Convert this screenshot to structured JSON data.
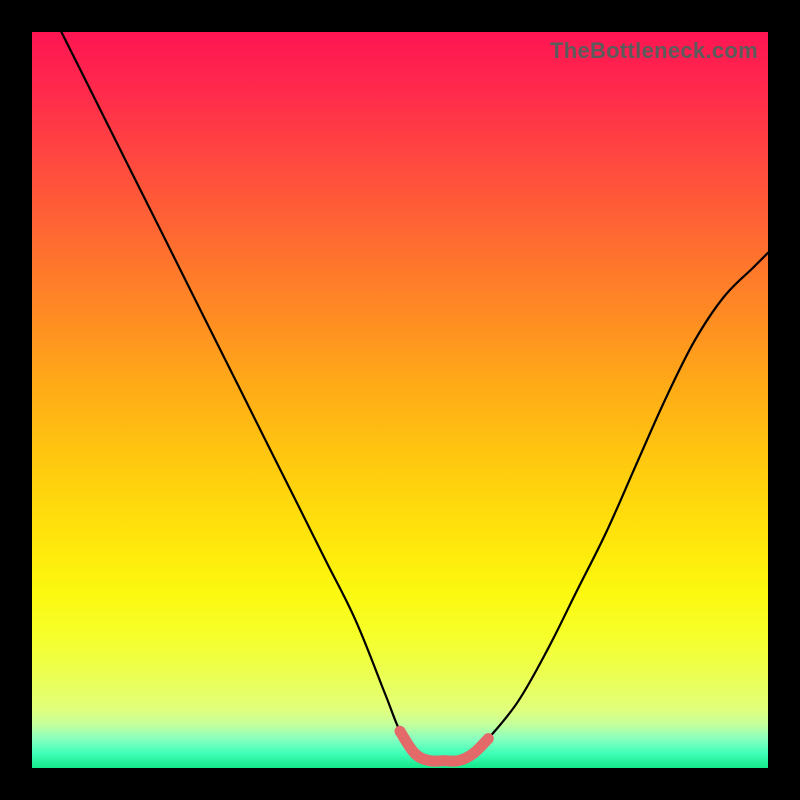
{
  "watermark": "TheBottleneck.com",
  "colors": {
    "frame": "#000000",
    "curve": "#000000",
    "accent": "#e46a6a",
    "gradient_top": "#ff1552",
    "gradient_bottom": "#14e88a"
  },
  "chart_data": {
    "type": "line",
    "title": "",
    "xlabel": "",
    "ylabel": "",
    "xlim": [
      0,
      100
    ],
    "ylim": [
      0,
      100
    ],
    "grid": false,
    "legend": false,
    "note": "Axes unlabeled in source; x treated as 0–100 left→right, y as 0–100 bottom→top. Values estimated from pixel positions.",
    "series": [
      {
        "name": "bottleneck-curve",
        "x": [
          4,
          8,
          12,
          16,
          20,
          24,
          28,
          32,
          36,
          40,
          44,
          48,
          50,
          52,
          54,
          56,
          58,
          60,
          62,
          66,
          70,
          74,
          78,
          82,
          86,
          90,
          94,
          98,
          100
        ],
        "y": [
          100,
          92,
          84,
          76,
          68,
          60,
          52,
          44,
          36,
          28,
          20,
          10,
          5,
          2,
          1,
          1,
          1,
          2,
          4,
          9,
          16,
          24,
          32,
          41,
          50,
          58,
          64,
          68,
          70
        ]
      },
      {
        "name": "sweet-spot-highlight",
        "x": [
          50,
          52,
          54,
          56,
          58,
          60,
          62
        ],
        "y": [
          5,
          2,
          1,
          1,
          1,
          2,
          4
        ]
      }
    ]
  }
}
